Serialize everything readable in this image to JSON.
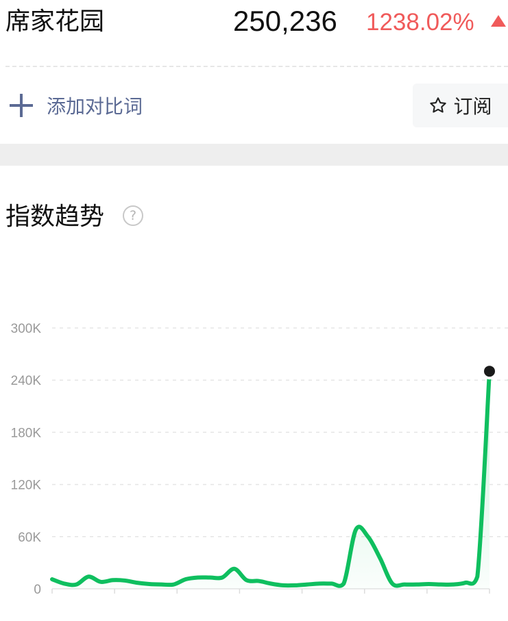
{
  "header": {
    "keyword": "席家花园",
    "value": "250,236",
    "change": "1238.02%",
    "change_color": "#f05a5a",
    "change_icon": "triangle-up-icon"
  },
  "actions": {
    "add_compare_label": "添加对比词",
    "add_compare_icon": "plus-icon",
    "subscribe_label": "订阅",
    "subscribe_icon": "star-outline-icon"
  },
  "section": {
    "title": "指数趋势",
    "help_icon": "question-circle-icon",
    "help_glyph": "?"
  },
  "colors": {
    "line": "#0fbf5f",
    "accent_text": "#5b6a94",
    "marker": "#1a1a1a"
  },
  "chart_data": {
    "type": "line",
    "title": "",
    "xlabel": "",
    "ylabel": "",
    "ylim": [
      0,
      300000
    ],
    "y_ticks": [
      0,
      60000,
      120000,
      180000,
      240000,
      300000
    ],
    "y_tick_labels": [
      "0",
      "60K",
      "120K",
      "180K",
      "240K",
      "300K"
    ],
    "x_tick_count": 8,
    "grid": true,
    "legend": "none",
    "series": [
      {
        "values": [
          11000,
          6000,
          5000,
          14000,
          8000,
          10000,
          9500,
          7000,
          5500,
          5000,
          5000,
          11000,
          13000,
          13000,
          13000,
          23000,
          10000,
          9000,
          6000,
          4000,
          4000,
          5000,
          6000,
          6000,
          6000,
          68000,
          60000,
          35000,
          6000,
          5000,
          5000,
          5500,
          5000,
          5000,
          7000,
          14000,
          250236
        ]
      }
    ],
    "last_point_marker": true
  }
}
